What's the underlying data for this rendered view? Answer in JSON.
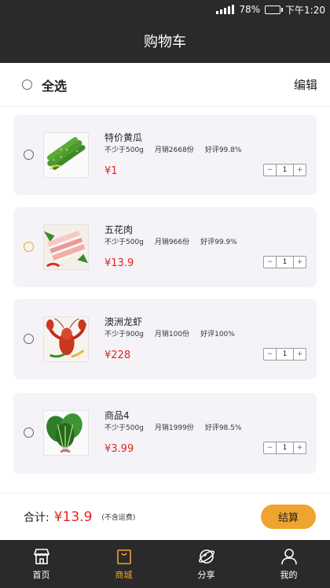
{
  "status_bar": {
    "battery": "78%",
    "time": "下午1:20",
    "battery_level": 0.78
  },
  "header": {
    "title": "购物车"
  },
  "toolbar": {
    "select_all": "全选",
    "edit": "编辑"
  },
  "items": [
    {
      "name": "特价黄瓜",
      "min": "不少于500g",
      "sales": "月销2668份",
      "rating": "好评99.8%",
      "price": "¥1",
      "qty": "1",
      "selected_state": "unselected",
      "image_icon": "cucumber-image"
    },
    {
      "name": "五花肉",
      "min": "不少于500g",
      "sales": "月销966份",
      "rating": "好评99.9%",
      "price": "¥13.9",
      "qty": "1",
      "selected_state": "highlighted",
      "image_icon": "pork-belly-image"
    },
    {
      "name": "澳洲龙虾",
      "min": "不少于900g",
      "sales": "月销100份",
      "rating": "好评100%",
      "price": "¥228",
      "qty": "1",
      "selected_state": "unselected",
      "image_icon": "lobster-image"
    },
    {
      "name": "商品4",
      "min": "不少于500g",
      "sales": "月销1999份",
      "rating": "好评98.5%",
      "price": "¥3.99",
      "qty": "1",
      "selected_state": "unselected",
      "image_icon": "spinach-image"
    }
  ],
  "stepper": {
    "minus": "−",
    "plus": "+"
  },
  "footer": {
    "total_label": "合计:",
    "total": "¥13.9",
    "note": "(不含运费)",
    "checkout": "结算"
  },
  "tabs": [
    {
      "label": "首页",
      "icon": "store-icon",
      "active": false
    },
    {
      "label": "商城",
      "icon": "shopping-bag-icon",
      "active": true
    },
    {
      "label": "分享",
      "icon": "share-planet-icon",
      "active": false
    },
    {
      "label": "我的",
      "icon": "user-icon",
      "active": false
    }
  ],
  "colors": {
    "bar_bg": "#2a2a2a",
    "accent": "#f0a430",
    "price": "#e8231c",
    "card_bg": "#f5f3f8"
  }
}
